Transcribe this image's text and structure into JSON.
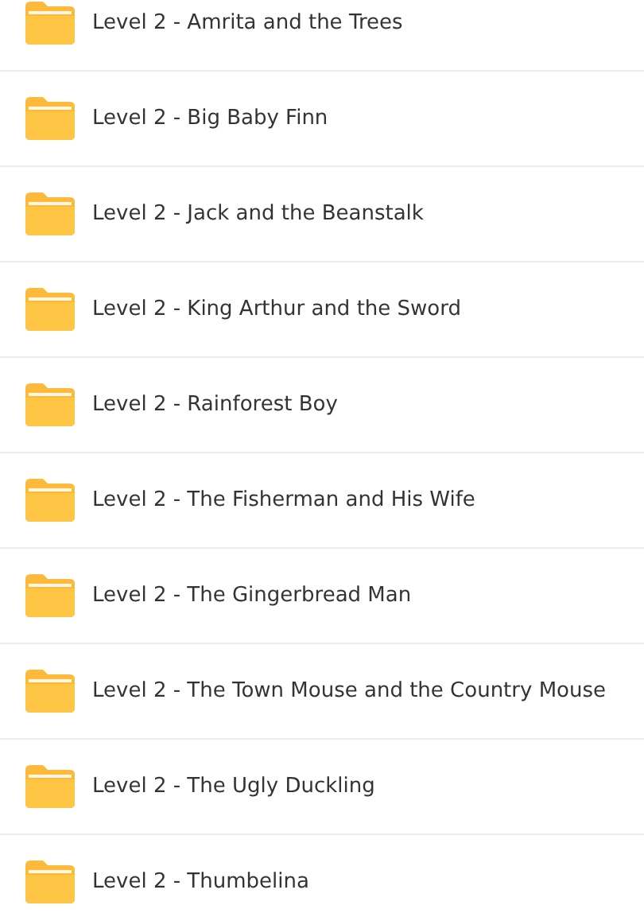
{
  "folders": [
    {
      "name": "Level 2 - Amrita and the Trees"
    },
    {
      "name": "Level 2 - Big Baby Finn"
    },
    {
      "name": "Level 2 - Jack and the Beanstalk"
    },
    {
      "name": "Level 2 - King Arthur and the Sword"
    },
    {
      "name": "Level 2 - Rainforest Boy"
    },
    {
      "name": "Level 2 - The Fisherman and His Wife"
    },
    {
      "name": "Level 2 - The Gingerbread Man"
    },
    {
      "name": "Level 2 - The Town Mouse and the Country Mouse"
    },
    {
      "name": "Level 2 - The Ugly Duckling"
    },
    {
      "name": "Level 2 - Thumbelina"
    }
  ]
}
